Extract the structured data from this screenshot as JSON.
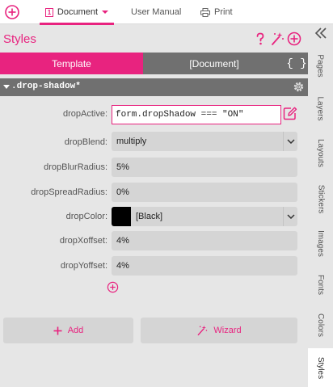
{
  "colors": {
    "accent": "#e8237f",
    "tab_inactive": "#707070",
    "field_bg": "#d5d5d5",
    "panel_bg": "#e6e6e6"
  },
  "topbar": {
    "add_icon": "circle-plus-icon",
    "tabs": [
      {
        "label": "Document",
        "icon": "document-icon",
        "has_dropdown": true,
        "active": true
      },
      {
        "label": "User Manual"
      },
      {
        "label": "Print",
        "icon": "printer-icon"
      }
    ]
  },
  "panel": {
    "title": "Styles",
    "icons": [
      "help-icon",
      "wand-icon",
      "circle-plus-icon"
    ],
    "mode_tabs": {
      "template": "Template",
      "document": "[Document]",
      "code": "{ }"
    },
    "rule": {
      "name": ".drop-shadow*",
      "settings_icon": "gear-icon"
    },
    "properties": {
      "dropActive": {
        "label": "dropActive:",
        "value": "form.dropShadow === \"ON\""
      },
      "dropBlend": {
        "label": "dropBlend:",
        "value": "multiply"
      },
      "dropBlurRadius": {
        "label": "dropBlurRadius:",
        "value": "5%"
      },
      "dropSpreadRadius": {
        "label": "dropSpreadRadius:",
        "value": "0%"
      },
      "dropColor": {
        "label": "dropColor:",
        "value": "[Black]",
        "swatch": "#000000"
      },
      "dropXoffset": {
        "label": "dropXoffset:",
        "value": "4%"
      },
      "dropYoffset": {
        "label": "dropYoffset:",
        "value": "4%"
      }
    },
    "buttons": {
      "add": "Add",
      "wizard": "Wizard"
    }
  },
  "sidebar": {
    "collapse_icon": "double-chevron-left-icon",
    "tabs": [
      "Pages",
      "Layers",
      "Layouts",
      "Stickers",
      "Images",
      "Fonts",
      "Colors",
      "Styles"
    ],
    "active": "Styles"
  }
}
